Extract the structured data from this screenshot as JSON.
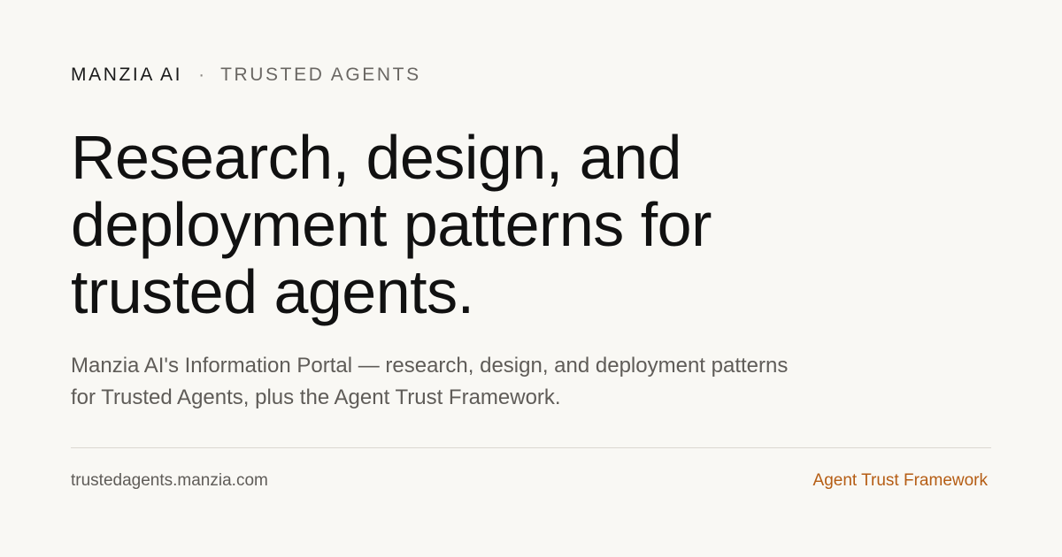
{
  "eyebrow": {
    "brand": "MANZIA AI",
    "separator": "·",
    "section": "TRUSTED AGENTS"
  },
  "headline": "Research, design, and deployment patterns for trusted agents.",
  "description": "Manzia AI's Information Portal — research, design, and deployment patterns for Trusted Agents, plus the Agent Trust Framework.",
  "footer": {
    "url": "trustedagents.manzia.com",
    "link_label": "Agent Trust Framework"
  },
  "colors": {
    "background": "#f9f8f4",
    "text": "#111111",
    "muted": "#5f5c58",
    "accent": "#b55d14",
    "divider": "#dcd8d1"
  }
}
